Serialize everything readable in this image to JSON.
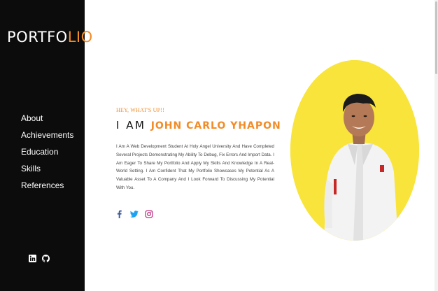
{
  "brand": {
    "part1": "PORTFO",
    "part2": "LIO",
    "accent_color": "#f28c28"
  },
  "sidebar": {
    "items": [
      {
        "label": "About"
      },
      {
        "label": "Achievements"
      },
      {
        "label": "Education"
      },
      {
        "label": "Skills"
      },
      {
        "label": "References"
      }
    ],
    "social_icons": [
      "linkedin-icon",
      "github-icon"
    ]
  },
  "hero": {
    "greeting": "HEY, WHAT'S UP!!",
    "headline_prefix": "I AM",
    "name": "JOHN CARLO YHAPON",
    "bio": "I Am A Web Development Student At Holy Angel University And Have Completed Several Projects Demonstrating My Ability To Debug, Fix Errors And Import Data. I Am Eager To Share My Portfolio And Apply My Skills And Knowledge In A Real-World Setting. I Am Confident That My Portfolio Showcases My Potential As A Valuable Asset To A Company And I Look Forward To Discussing My Potential With You.",
    "social_icons": [
      "facebook-icon",
      "twitter-icon",
      "instagram-icon"
    ],
    "social_colors": {
      "facebook": "#3b5998",
      "twitter": "#1da1f2",
      "instagram": "#c13584"
    },
    "photo_bg_color": "#f8e43a"
  }
}
